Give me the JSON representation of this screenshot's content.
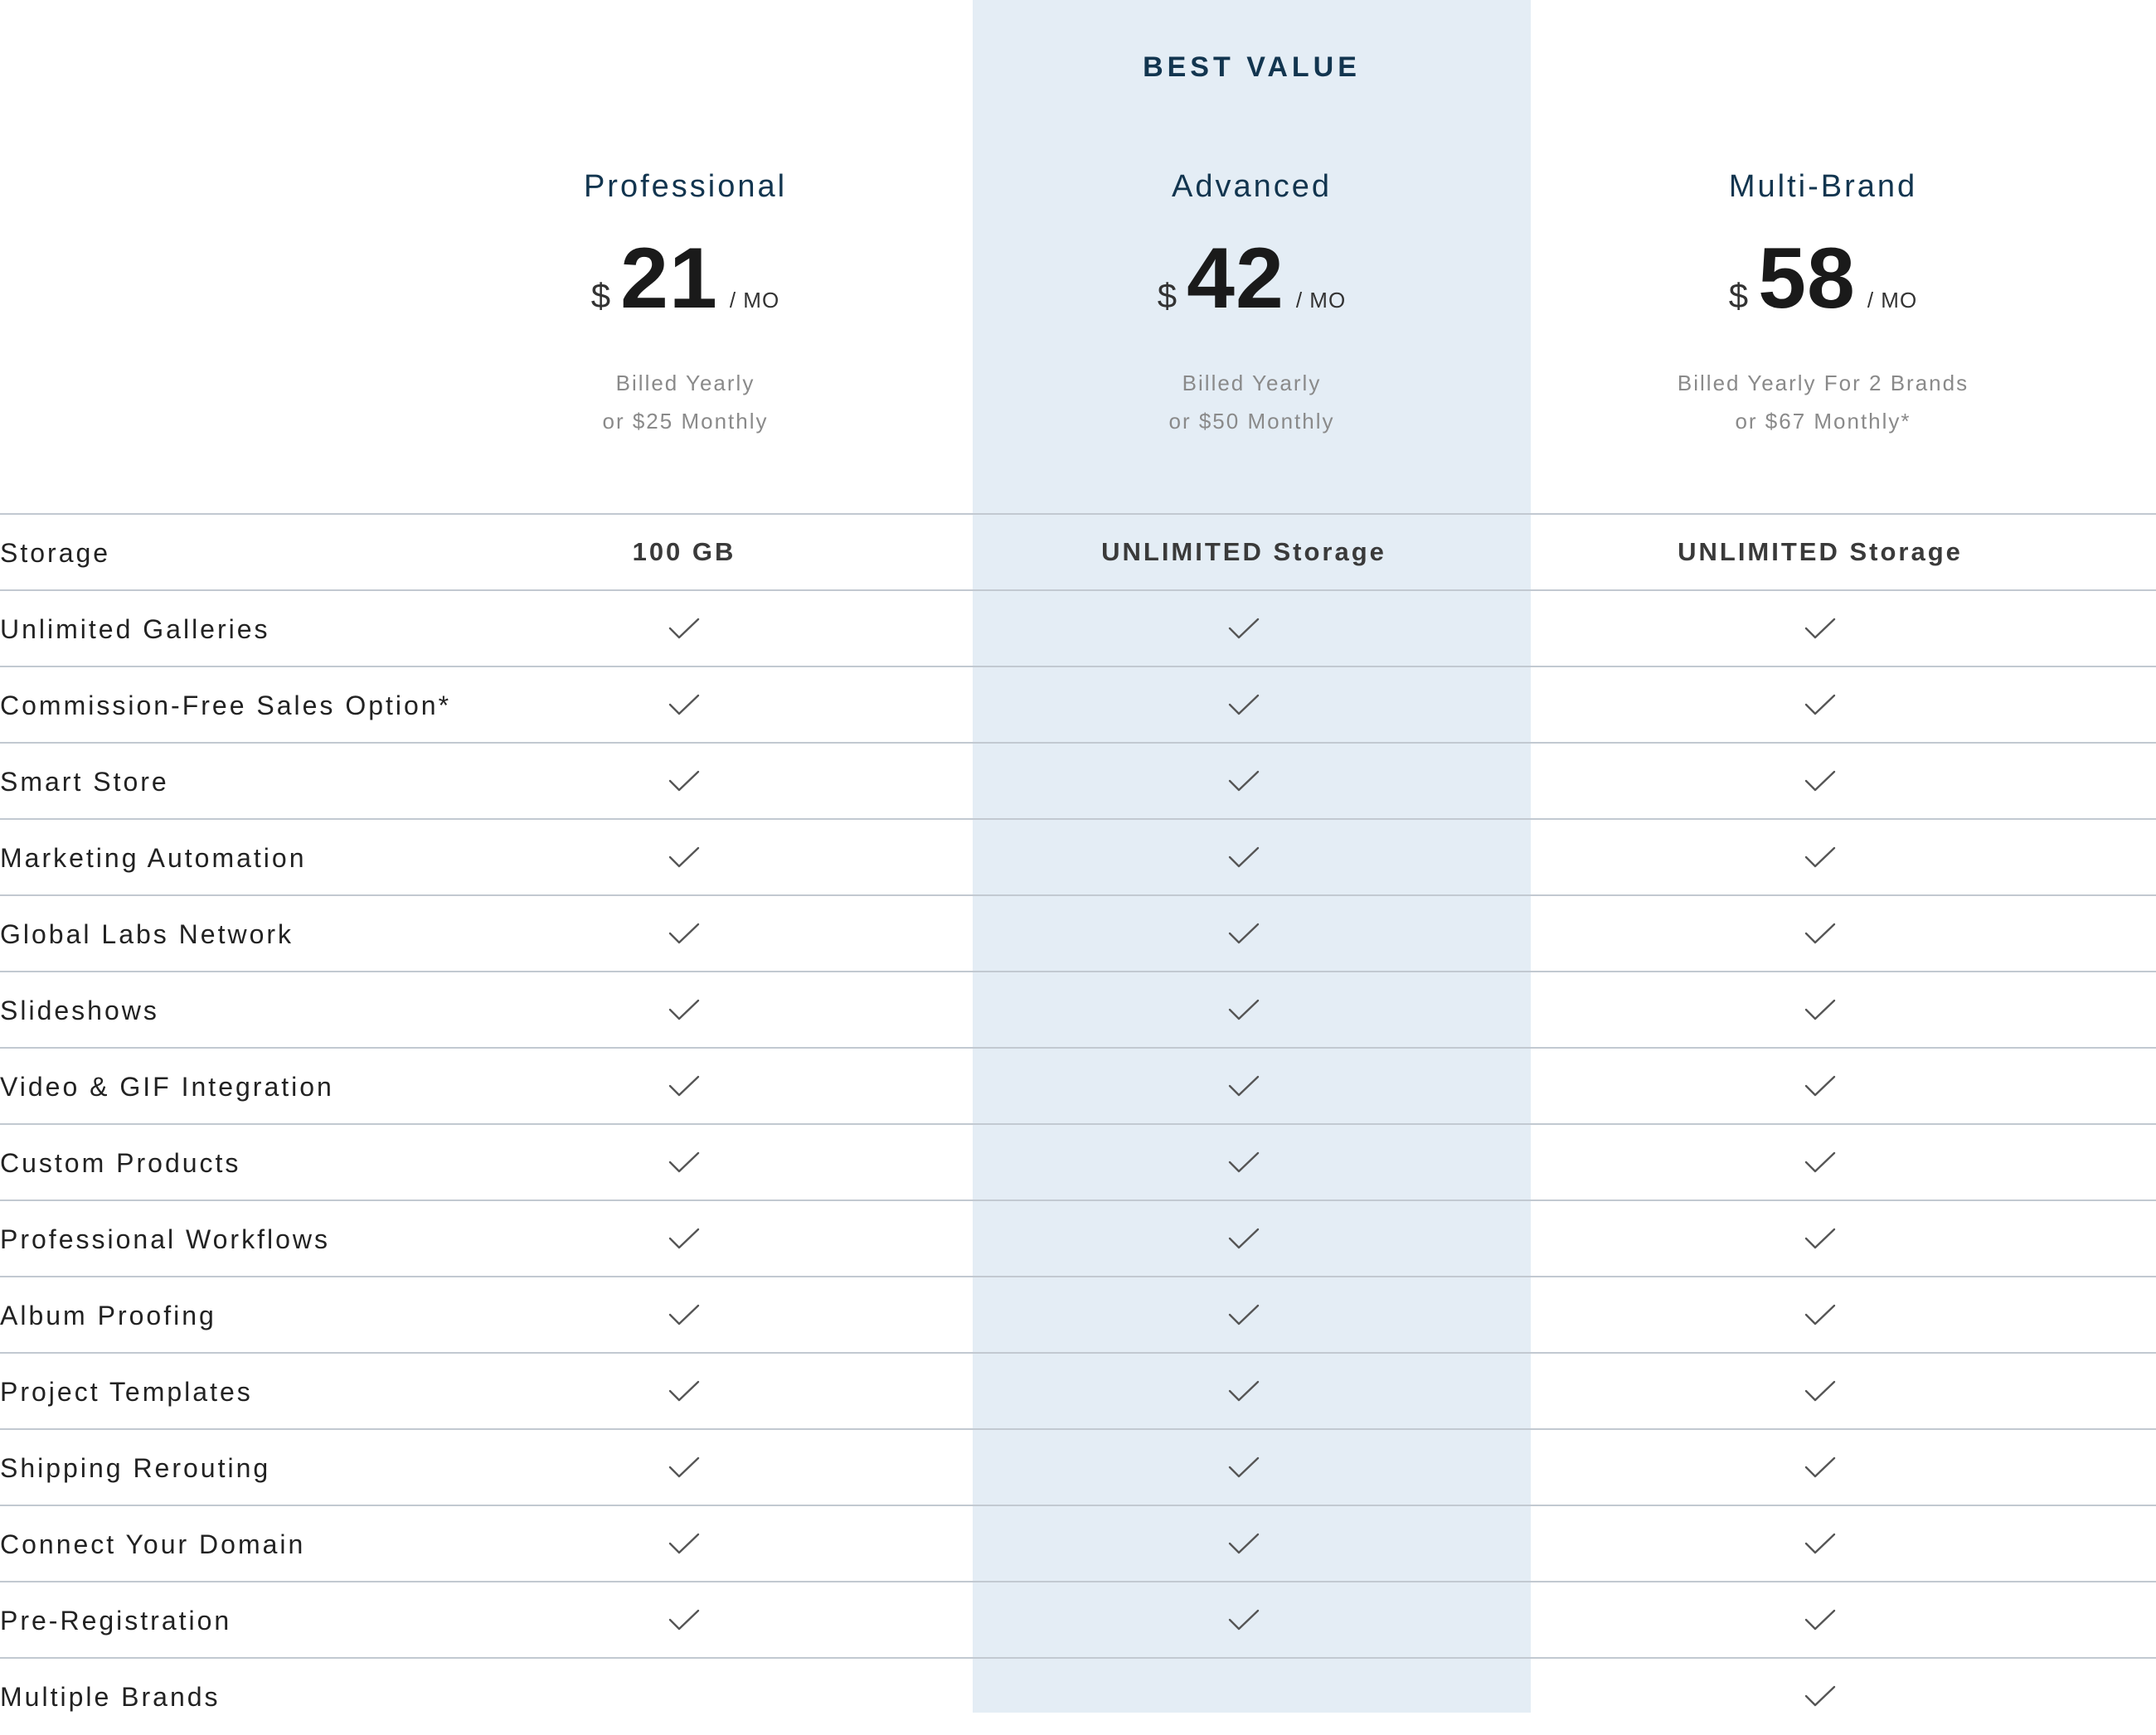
{
  "best_value_label": "BEST VALUE",
  "plans": [
    {
      "name": "Professional",
      "currency": "$",
      "amount": "21",
      "per": "/ MO",
      "billing_line1": "Billed Yearly",
      "billing_line2": "or $25 Monthly"
    },
    {
      "name": "Advanced",
      "currency": "$",
      "amount": "42",
      "per": "/ MO",
      "billing_line1": "Billed Yearly",
      "billing_line2": "or $50 Monthly"
    },
    {
      "name": "Multi-Brand",
      "currency": "$",
      "amount": "58",
      "per": "/ MO",
      "billing_line1": "Billed Yearly For 2 Brands",
      "billing_line2": "or $67 Monthly*"
    }
  ],
  "features": [
    {
      "label": "Storage",
      "values": [
        "100 GB",
        "UNLIMITED Storage",
        "UNLIMITED Storage"
      ]
    },
    {
      "label": "Unlimited Galleries",
      "values": [
        true,
        true,
        true
      ]
    },
    {
      "label": "Commission-Free Sales Option*",
      "values": [
        true,
        true,
        true
      ]
    },
    {
      "label": "Smart Store",
      "values": [
        true,
        true,
        true
      ]
    },
    {
      "label": "Marketing Automation",
      "values": [
        true,
        true,
        true
      ]
    },
    {
      "label": "Global Labs Network",
      "values": [
        true,
        true,
        true
      ]
    },
    {
      "label": "Slideshows",
      "values": [
        true,
        true,
        true
      ]
    },
    {
      "label": "Video & GIF Integration",
      "values": [
        true,
        true,
        true
      ]
    },
    {
      "label": "Custom Products",
      "values": [
        true,
        true,
        true
      ]
    },
    {
      "label": "Professional Workflows",
      "values": [
        true,
        true,
        true
      ]
    },
    {
      "label": "Album Proofing",
      "values": [
        true,
        true,
        true
      ]
    },
    {
      "label": "Project Templates",
      "values": [
        true,
        true,
        true
      ]
    },
    {
      "label": "Shipping Rerouting",
      "values": [
        true,
        true,
        true
      ]
    },
    {
      "label": "Connect Your Domain",
      "values": [
        true,
        true,
        true
      ]
    },
    {
      "label": "Pre-Registration",
      "values": [
        true,
        true,
        true
      ]
    },
    {
      "label": "Multiple Brands",
      "values": [
        false,
        false,
        true
      ]
    }
  ],
  "icons": {
    "included": "check-icon"
  },
  "colors": {
    "accent": "#12354f",
    "highlight_bg": "#e4edf5",
    "divider": "#c2c9d1",
    "muted_text": "#8a8a8a"
  }
}
